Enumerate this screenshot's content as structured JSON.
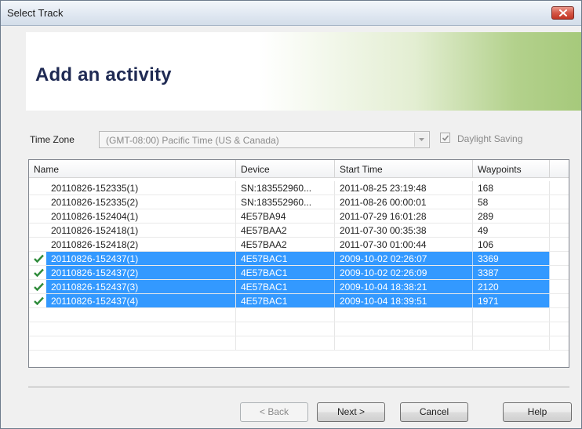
{
  "window": {
    "title": "Select Track"
  },
  "banner": {
    "title": "Add an activity"
  },
  "timezone": {
    "label": "Time Zone",
    "value": "(GMT-08:00) Pacific Time (US & Canada)",
    "daylight_label": "Daylight Saving",
    "daylight_checked": true
  },
  "table": {
    "columns": [
      "Name",
      "Device",
      "Start Time",
      "Waypoints"
    ],
    "rows": [
      {
        "name": "20110826-152335(1)",
        "device": "SN:183552960...",
        "start": "2011-08-25 23:19:48",
        "waypoints": "168",
        "selected": false
      },
      {
        "name": "20110826-152335(2)",
        "device": "SN:183552960...",
        "start": "2011-08-26 00:00:01",
        "waypoints": "58",
        "selected": false
      },
      {
        "name": "20110826-152404(1)",
        "device": "4E57BA94",
        "start": "2011-07-29 16:01:28",
        "waypoints": "289",
        "selected": false
      },
      {
        "name": "20110826-152418(1)",
        "device": "4E57BAA2",
        "start": "2011-07-30 00:35:38",
        "waypoints": "49",
        "selected": false
      },
      {
        "name": "20110826-152418(2)",
        "device": "4E57BAA2",
        "start": "2011-07-30 01:00:44",
        "waypoints": "106",
        "selected": false
      },
      {
        "name": "20110826-152437(1)",
        "device": "4E57BAC1",
        "start": "2009-10-02 02:26:07",
        "waypoints": "3369",
        "selected": true
      },
      {
        "name": "20110826-152437(2)",
        "device": "4E57BAC1",
        "start": "2009-10-02 02:26:09",
        "waypoints": "3387",
        "selected": true
      },
      {
        "name": "20110826-152437(3)",
        "device": "4E57BAC1",
        "start": "2009-10-04 18:38:21",
        "waypoints": "2120",
        "selected": true
      },
      {
        "name": "20110826-152437(4)",
        "device": "4E57BAC1",
        "start": "2009-10-04 18:39:51",
        "waypoints": "1971",
        "selected": true
      }
    ]
  },
  "buttons": {
    "back": "< Back",
    "next": "Next >",
    "cancel": "Cancel",
    "help": "Help"
  },
  "colors": {
    "selection": "#3399ff",
    "banner_title": "#1f2a53",
    "check": "#2e8b3a"
  },
  "icons": {
    "close": "close-icon",
    "dropdown": "chevron-down-icon",
    "row_check": "checkmark-icon"
  }
}
